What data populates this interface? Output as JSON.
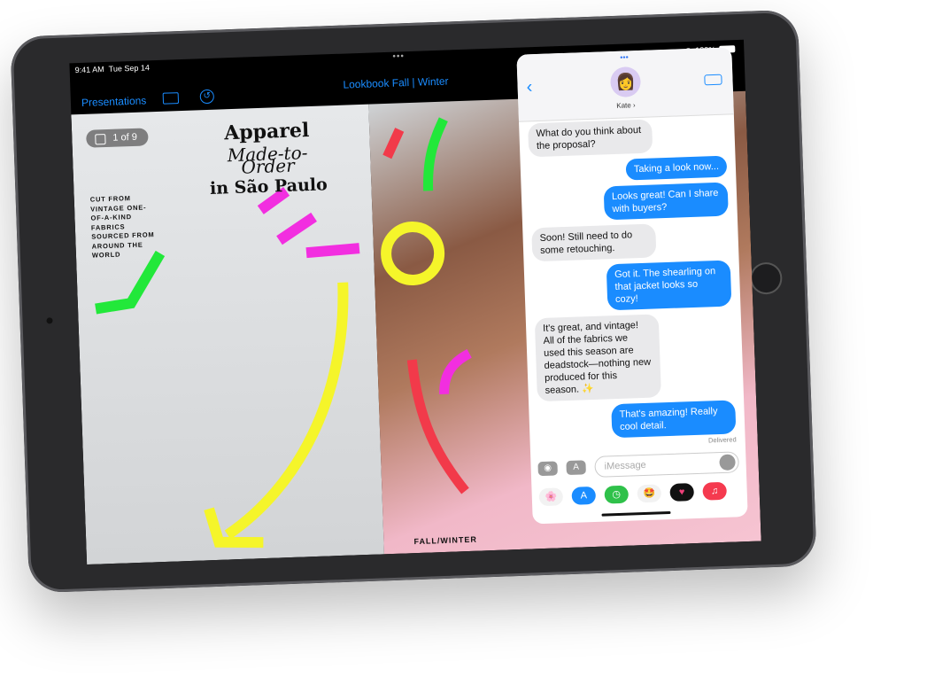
{
  "status": {
    "time": "9:41 AM",
    "date": "Tue Sep 14",
    "battery": "100%"
  },
  "toolbar": {
    "back_label": "Presentations",
    "title": "Lookbook Fall | Winter",
    "accent": "#1a8cff"
  },
  "slide": {
    "counter": "1 of 9",
    "headline": [
      "Apparel",
      "Made-to-Order",
      "in São Paulo"
    ],
    "side_text": "CUT FROM VINTAGE ONE-OF-A-KIND FABRICS SOURCED FROM AROUND THE WORLD",
    "footer": "FALL/WINTER"
  },
  "messages": {
    "contact": "Kate ›",
    "thread": [
      {
        "dir": "in",
        "text": "What do you think about the proposal?"
      },
      {
        "dir": "out",
        "text": "Taking a look now..."
      },
      {
        "dir": "out",
        "text": "Looks great! Can I share with buyers?"
      },
      {
        "dir": "in",
        "text": "Soon! Still need to do some retouching."
      },
      {
        "dir": "out",
        "text": "Got it. The shearling on that jacket looks so cozy!"
      },
      {
        "dir": "in",
        "text": "It's great, and vintage! All of the fabrics we used this season are deadstock—nothing new produced for this season. ✨"
      },
      {
        "dir": "out",
        "text": "That's amazing! Really cool detail."
      }
    ],
    "delivered": "Delivered",
    "input_placeholder": "iMessage",
    "apps": [
      "photos",
      "app-store",
      "clock",
      "memoji-stickers",
      "heart-digital-touch",
      "music"
    ]
  }
}
